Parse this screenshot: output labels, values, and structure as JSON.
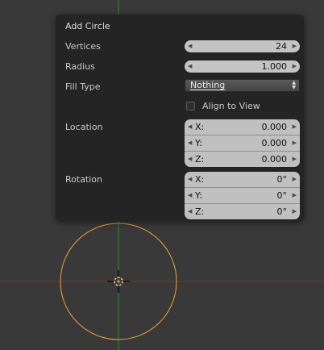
{
  "panel": {
    "title": "Add Circle",
    "vertices": {
      "label": "Vertices",
      "value": "24"
    },
    "radius": {
      "label": "Radius",
      "value": "1.000"
    },
    "fill_type": {
      "label": "Fill Type",
      "value": "Nothing"
    },
    "align_to_view": {
      "label": "Align to View",
      "checked": false
    },
    "location": {
      "label": "Location",
      "fields": [
        {
          "axis": "X:",
          "value": "0.000"
        },
        {
          "axis": "Y:",
          "value": "0.000"
        },
        {
          "axis": "Z:",
          "value": "0.000"
        }
      ]
    },
    "rotation": {
      "label": "Rotation",
      "fields": [
        {
          "axis": "X:",
          "value": "0°"
        },
        {
          "axis": "Y:",
          "value": "0°"
        },
        {
          "axis": "Z:",
          "value": "0°"
        }
      ]
    }
  },
  "colors": {
    "background": "#393939",
    "x_axis": "#8a2a2a",
    "y_axis": "#2f8a2f",
    "selection": "#f2a531"
  },
  "icons": {
    "left_arrow": "left-arrow-icon",
    "right_arrow": "right-arrow-icon",
    "dropdown": "up-down-caret-icon",
    "cursor": "3d-cursor-icon"
  }
}
